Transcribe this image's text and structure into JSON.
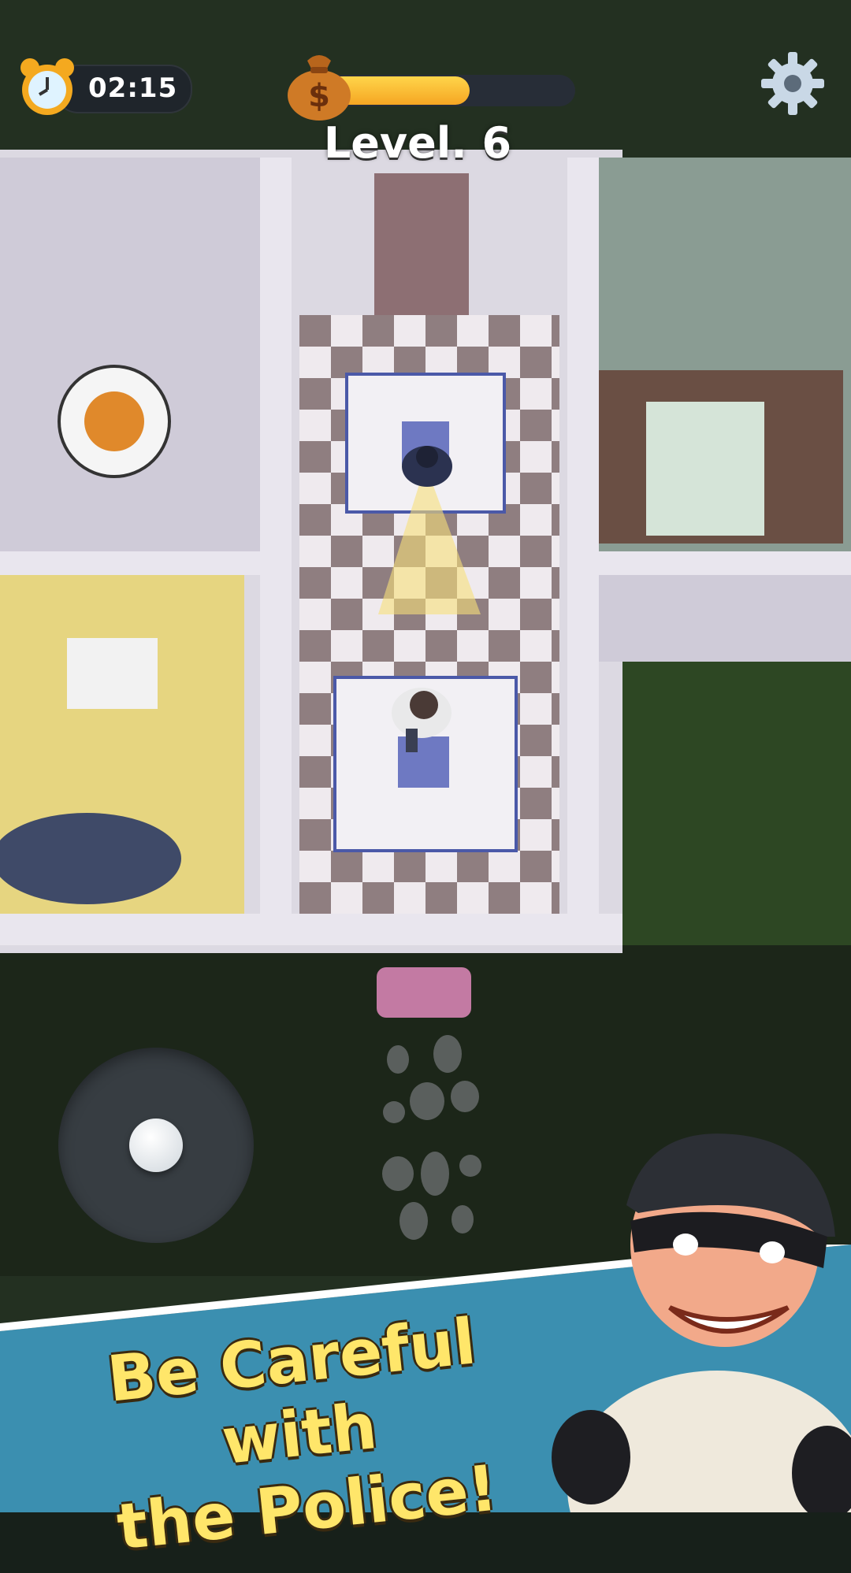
{
  "hud": {
    "timer": "02:15",
    "level": "Level. 6",
    "loot_progress": 0.6
  },
  "icons": {
    "timer": "alarm-clock-icon",
    "loot": "money-bag-icon",
    "settings": "gear-icon"
  },
  "banner": {
    "line1": "Be Careful with",
    "line2": "the  Police!"
  },
  "colors": {
    "progress_fill": "#f5a623",
    "banner_text": "#ffe66a",
    "banner_bg": "#3b8fb0"
  }
}
